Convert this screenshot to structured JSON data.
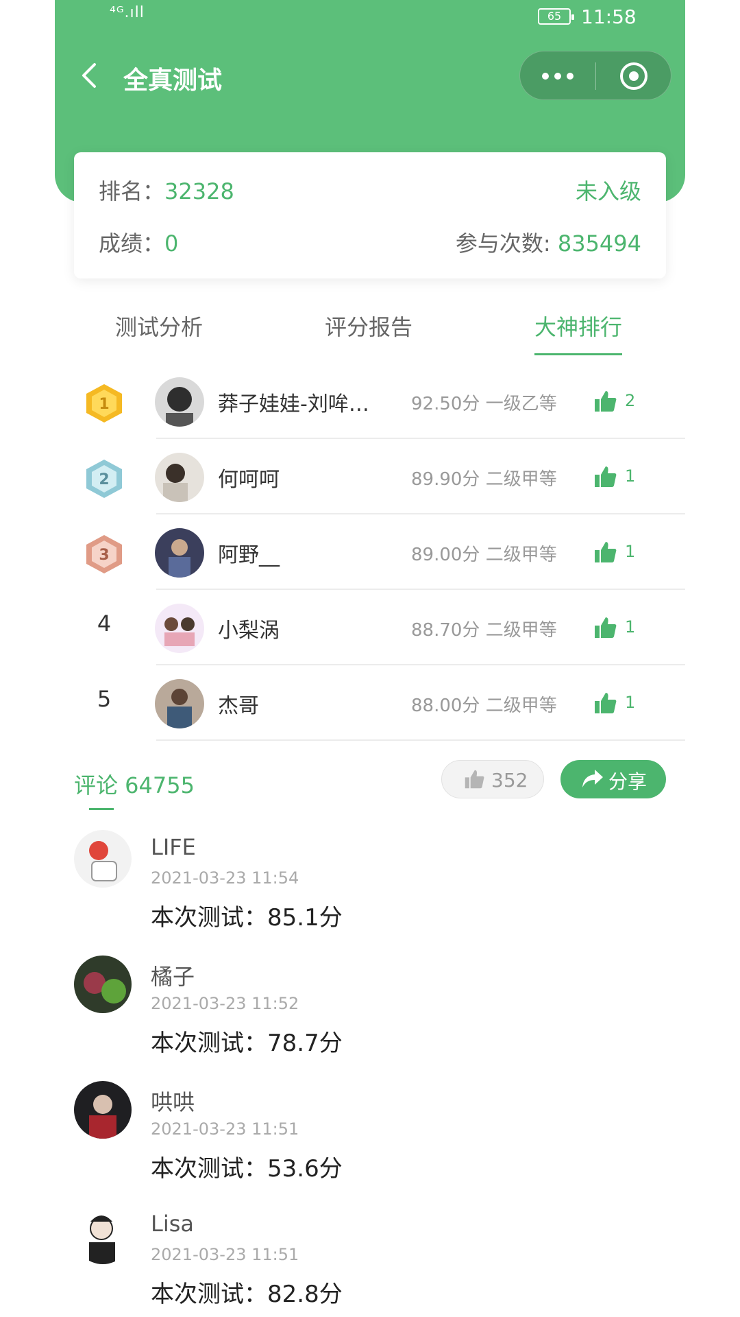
{
  "status_bar": {
    "signal": "⁴ᴳ.ıll",
    "battery": "65",
    "time": "11:58"
  },
  "nav": {
    "title": "全真测试"
  },
  "rank_card": {
    "rank_label": "排名：",
    "rank_value": "32328",
    "level": "未入级",
    "score_label": "成绩：",
    "score_value": "0",
    "attempts_label": "参与次数:",
    "attempts_value": "835494"
  },
  "tabs": [
    {
      "label": "测试分析"
    },
    {
      "label": "评分报告"
    },
    {
      "label": "大神排行",
      "active": true
    }
  ],
  "ranking": [
    {
      "rank": "1",
      "name": "莽子娃娃-刘哞…",
      "score": "92.50分 一级乙等",
      "likes": "2"
    },
    {
      "rank": "2",
      "name": "何呵呵",
      "score": "89.90分 二级甲等",
      "likes": "1"
    },
    {
      "rank": "3",
      "name": "阿野__",
      "score": "89.00分 二级甲等",
      "likes": "1"
    },
    {
      "rank": "4",
      "name": "小梨涡",
      "score": "88.70分 二级甲等",
      "likes": "1"
    },
    {
      "rank": "5",
      "name": "杰哥",
      "score": "88.00分 二级甲等",
      "likes": "1"
    }
  ],
  "comment_bar": {
    "label": "评论 64755",
    "likes": "352",
    "share_label": "分享"
  },
  "comments": [
    {
      "name": "LIFE",
      "time": "2021-03-23 11:54",
      "text": "本次测试：85.1分"
    },
    {
      "name": "橘子",
      "time": "2021-03-23 11:52",
      "text": "本次测试：78.7分"
    },
    {
      "name": "哄哄",
      "time": "2021-03-23 11:51",
      "text": "本次测试：53.6分"
    },
    {
      "name": "Lisa",
      "time": "2021-03-23 11:51",
      "text": "本次测试：82.8分"
    }
  ],
  "colors": {
    "primary": "#5cbf7a",
    "accent": "#4cb56e",
    "gold": "#f5b923",
    "silver": "#8fc9d6",
    "bronze": "#e09b86"
  }
}
